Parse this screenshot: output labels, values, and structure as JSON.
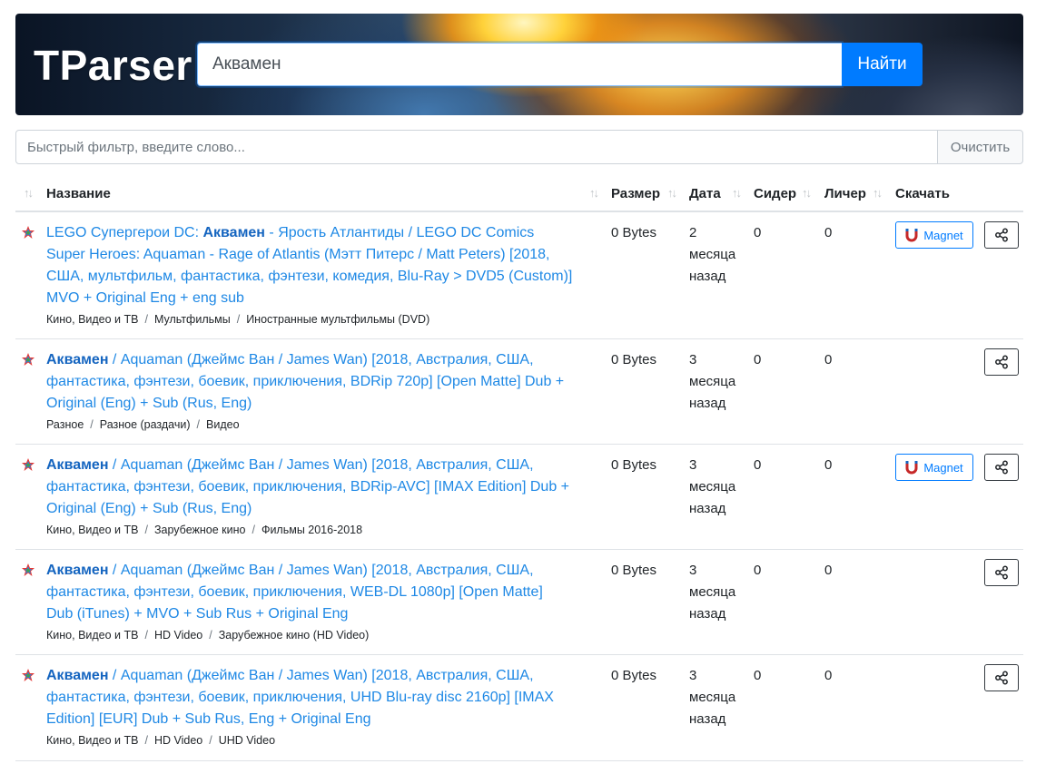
{
  "header": {
    "logo": "TParser",
    "search_value": "Аквамен",
    "search_button": "Найти"
  },
  "filter": {
    "placeholder": "Быстрый фильтр, введите слово...",
    "clear_button": "Очистить"
  },
  "table": {
    "columns": {
      "name": "Название",
      "size": "Размер",
      "date": "Дата",
      "seeders": "Сидер",
      "leechers": "Личер",
      "download": "Скачать"
    },
    "magnet_label": "Magnet",
    "rows": [
      {
        "title_pre": "LEGO Супергерои DC: ",
        "title_bold": "Аквамен",
        "title_post": " - Ярость Атлантиды / LEGO DC Comics Super Heroes: Aquaman - Rage of Atlantis (Мэтт Питерс / Matt Peters) [2018, США, мультфильм, фантастика, фэнтези, комедия, Blu-Ray > DVD5 (Custom)] MVO + Original Eng + eng sub",
        "cats": [
          "Кино, Видео и ТВ",
          "Мультфильмы",
          "Иностранные мультфильмы (DVD)"
        ],
        "size": "0 Bytes",
        "date": "2 месяца назад",
        "seeders": "0",
        "leechers": "0",
        "magnet": true
      },
      {
        "title_pre": "",
        "title_bold": "Аквамен",
        "title_post": " / Aquaman (Джеймс Ван / James Wan) [2018, Австралия, США, фантастика, фэнтези, боевик, приключения, BDRip 720p] [Open Matte] Dub + Original (Eng) + Sub (Rus, Eng)",
        "cats": [
          "Разное",
          "Разное (раздачи)",
          "Видео"
        ],
        "size": "0 Bytes",
        "date": "3 месяца назад",
        "seeders": "0",
        "leechers": "0",
        "magnet": false
      },
      {
        "title_pre": "",
        "title_bold": "Аквамен",
        "title_post": " / Aquaman (Джеймс Ван / James Wan) [2018, Австралия, США, фантастика, фэнтези, боевик, приключения, BDRip-AVC] [IMAX Edition] Dub + Original (Eng) + Sub (Rus, Eng)",
        "cats": [
          "Кино, Видео и ТВ",
          "Зарубежное кино",
          "Фильмы 2016-2018"
        ],
        "size": "0 Bytes",
        "date": "3 месяца назад",
        "seeders": "0",
        "leechers": "0",
        "magnet": true
      },
      {
        "title_pre": "",
        "title_bold": "Аквамен",
        "title_post": " / Aquaman (Джеймс Ван / James Wan) [2018, Австралия, США, фантастика, фэнтези, боевик, приключения, WEB-DL 1080p] [Open Matte] Dub (iTunes) + MVO + Sub Rus + Original Eng",
        "cats": [
          "Кино, Видео и ТВ",
          "HD Video",
          "Зарубежное кино (HD Video)"
        ],
        "size": "0 Bytes",
        "date": "3 месяца назад",
        "seeders": "0",
        "leechers": "0",
        "magnet": false
      },
      {
        "title_pre": "",
        "title_bold": "Аквамен",
        "title_post": " / Aquaman (Джеймс Ван / James Wan) [2018, Австралия, США, фантастика, фэнтези, боевик, приключения, UHD Blu-ray disc 2160p] [IMAX Edition] [EUR] Dub + Sub Rus, Eng + Original Eng",
        "cats": [
          "Кино, Видео и ТВ",
          "HD Video",
          "UHD Video"
        ],
        "size": "0 Bytes",
        "date": "3 месяца назад",
        "seeders": "0",
        "leechers": "0",
        "magnet": false
      }
    ]
  },
  "colors": {
    "primary": "#007bff",
    "link": "#1e88e5",
    "border": "#dee2e6"
  }
}
